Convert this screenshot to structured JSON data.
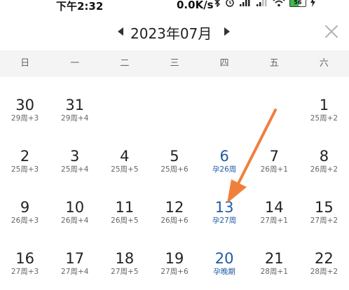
{
  "status_bar": {
    "time": "下午2:32",
    "network_speed": "0.0K/s",
    "battery_level": "56",
    "icons": [
      "bluetooth-icon",
      "alarm-icon",
      "signal-hd-icon",
      "signal-hd-icon-2",
      "wifi-icon",
      "battery-icon",
      "charging-icon"
    ]
  },
  "header": {
    "month_title": "2023年07月",
    "prev_icon": "left-triangle-icon",
    "next_icon": "right-triangle-icon",
    "close_icon": "close-x-icon"
  },
  "weekdays": [
    "日",
    "一",
    "二",
    "三",
    "四",
    "五",
    "六"
  ],
  "colors": {
    "accent": "#1f5ba6",
    "arrow": "#f07f3c",
    "weekday_bg": "#f4f4f4"
  },
  "weeks": [
    [
      {
        "day": "30",
        "sub": "29周+3"
      },
      {
        "day": "31",
        "sub": "29周+4"
      },
      {
        "day": "",
        "sub": ""
      },
      {
        "day": "",
        "sub": ""
      },
      {
        "day": "",
        "sub": ""
      },
      {
        "day": "",
        "sub": ""
      },
      {
        "day": "1",
        "sub": "25周+2"
      }
    ],
    [
      {
        "day": "2",
        "sub": "25周+3"
      },
      {
        "day": "3",
        "sub": "25周+4"
      },
      {
        "day": "4",
        "sub": "25周+5"
      },
      {
        "day": "5",
        "sub": "25周+6"
      },
      {
        "day": "6",
        "sub": "孕26周",
        "highlight": true
      },
      {
        "day": "7",
        "sub": "26周+1"
      },
      {
        "day": "8",
        "sub": "26周+2"
      }
    ],
    [
      {
        "day": "9",
        "sub": "26周+3"
      },
      {
        "day": "10",
        "sub": "26周+4"
      },
      {
        "day": "11",
        "sub": "26周+5"
      },
      {
        "day": "12",
        "sub": "26周+6"
      },
      {
        "day": "13",
        "sub": "孕27周",
        "highlight": true
      },
      {
        "day": "14",
        "sub": "27周+1"
      },
      {
        "day": "15",
        "sub": "27周+2"
      }
    ],
    [
      {
        "day": "16",
        "sub": "27周+3"
      },
      {
        "day": "17",
        "sub": "27周+4"
      },
      {
        "day": "18",
        "sub": "27周+5"
      },
      {
        "day": "19",
        "sub": "27周+6"
      },
      {
        "day": "20",
        "sub": "孕晚期",
        "highlight": true
      },
      {
        "day": "21",
        "sub": "28周+1"
      },
      {
        "day": "22",
        "sub": "28周+2"
      }
    ]
  ]
}
